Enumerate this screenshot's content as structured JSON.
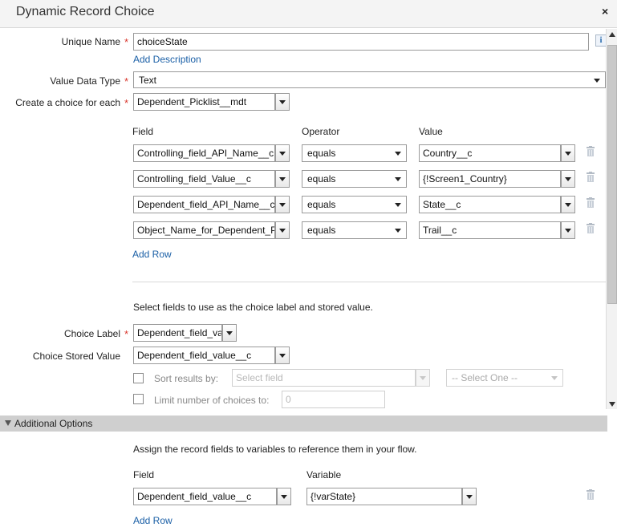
{
  "dialog": {
    "title": "Dynamic Record Choice",
    "close_glyph": "×"
  },
  "unique_name": {
    "label": "Unique Name",
    "value": "choiceState",
    "add_description": "Add Description",
    "info_glyph": "i"
  },
  "value_data_type": {
    "label": "Value Data Type",
    "value": "Text"
  },
  "create_choice": {
    "label": "Create a choice for each",
    "value": "Dependent_Picklist__mdt"
  },
  "filters": {
    "headers": {
      "field": "Field",
      "operator": "Operator",
      "value": "Value"
    },
    "rows": [
      {
        "field": "Controlling_field_API_Name__c",
        "operator": "equals",
        "value": "Country__c"
      },
      {
        "field": "Controlling_field_Value__c",
        "operator": "equals",
        "value": "{!Screen1_Country}"
      },
      {
        "field": "Dependent_field_API_Name__c",
        "operator": "equals",
        "value": "State__c"
      },
      {
        "field": "Object_Name_for_Dependent_P",
        "operator": "equals",
        "value": "Trail__c"
      }
    ],
    "add_row": "Add Row"
  },
  "choice_fields": {
    "instruction": "Select fields to use as the choice label and stored value.",
    "label_label": "Choice Label",
    "label_value": "Dependent_field_va",
    "stored_label": "Choice Stored Value",
    "stored_value": "Dependent_field_value__c",
    "sort_label": "Sort results by:",
    "sort_field_placeholder": "Select field",
    "sort_order_value": "-- Select One --",
    "limit_label": "Limit number of choices to:",
    "limit_value": "0"
  },
  "additional_options": {
    "title": "Additional Options",
    "instruction": "Assign the record fields to variables to reference them in your flow.",
    "headers": {
      "field": "Field",
      "variable": "Variable"
    },
    "row": {
      "field": "Dependent_field_value__c",
      "variable": "{!varState}"
    },
    "add_row": "Add Row"
  },
  "colors": {
    "required": "#d9352b",
    "link": "#1a5fa6",
    "section_bar": "#cfcfcf"
  }
}
